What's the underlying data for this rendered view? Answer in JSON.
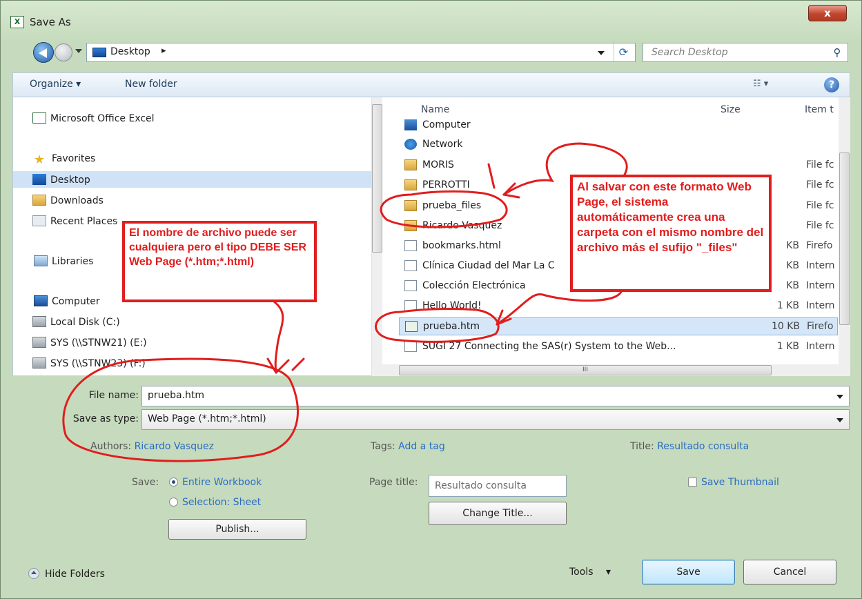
{
  "window": {
    "title": "Save As",
    "close_label": "x"
  },
  "address": {
    "location": "Desktop",
    "separator": "▸",
    "search_placeholder": "Search Desktop"
  },
  "toolbar": {
    "organize": "Organize ▾",
    "new_folder": "New folder",
    "view": "☷ ▾",
    "help": "?"
  },
  "nav": {
    "app": "Microsoft Office Excel",
    "favorites": "Favorites",
    "desktop": "Desktop",
    "downloads": "Downloads",
    "recent": "Recent Places",
    "libraries": "Libraries",
    "computer": "Computer",
    "drive_c": "Local Disk (C:)",
    "drive_e": "SYS (\\\\STNW21) (E:)",
    "drive_f": "SYS (\\\\STNW23) (F:)"
  },
  "columns": {
    "name": "Name",
    "size": "Size",
    "type": "Item t"
  },
  "files": [
    {
      "name": "Computer",
      "size": "",
      "type": ""
    },
    {
      "name": "Network",
      "size": "",
      "type": ""
    },
    {
      "name": "MORIS",
      "size": "",
      "type": "File fc"
    },
    {
      "name": "PERROTTI",
      "size": "",
      "type": "File fc"
    },
    {
      "name": "prueba_files",
      "size": "",
      "type": "File fc"
    },
    {
      "name": "Ricardo Vasquez",
      "size": "",
      "type": "File fc"
    },
    {
      "name": "bookmarks.html",
      "size": "KB",
      "type": "Firefo"
    },
    {
      "name": "Clínica Ciudad del Mar La C",
      "size": "KB",
      "type": "Intern"
    },
    {
      "name": "Colección Electrónica",
      "size": "KB",
      "type": "Intern"
    },
    {
      "name": "Hello World!",
      "size": "1 KB",
      "type": "Intern"
    },
    {
      "name": "prueba.htm",
      "size": "10 KB",
      "type": "Firefo"
    },
    {
      "name": "SUGI 27 Connecting the SAS(r) System to the Web...",
      "size": "1 KB",
      "type": "Intern"
    }
  ],
  "scroll_grip": "III",
  "form": {
    "filename_label": "File name:",
    "filename_value": "prueba.htm",
    "type_label": "Save as type:",
    "type_value": "Web Page (*.htm;*.html)"
  },
  "meta": {
    "authors_label": "Authors:",
    "authors_value": "Ricardo Vasquez",
    "tags_label": "Tags:",
    "tags_value": "Add a tag",
    "title_label": "Title:",
    "title_value": "Resultado consulta"
  },
  "options": {
    "save_label": "Save:",
    "entire": "Entire Workbook",
    "selection": "Selection: Sheet",
    "publish": "Publish...",
    "page_title_label": "Page title:",
    "page_title_value": "Resultado consulta",
    "change_title": "Change Title...",
    "thumbnail": "Save Thumbnail"
  },
  "footer": {
    "hide_folders": "Hide Folders",
    "tools": "Tools",
    "save": "Save",
    "cancel": "Cancel"
  },
  "annotations": {
    "left": "El nombre de archivo puede ser cualquiera pero el tipo DEBE SER Web Page (*.htm;*.html)",
    "right": "Al salvar con este formato Web Page, el sistema automáticamente crea una carpeta con el mismo nombre del archivo más el sufijo \"_files\""
  },
  "colors": {
    "annotation_red": "#e11d1d",
    "link_blue": "#2b6cc4",
    "selection": "#cfe2f6"
  }
}
